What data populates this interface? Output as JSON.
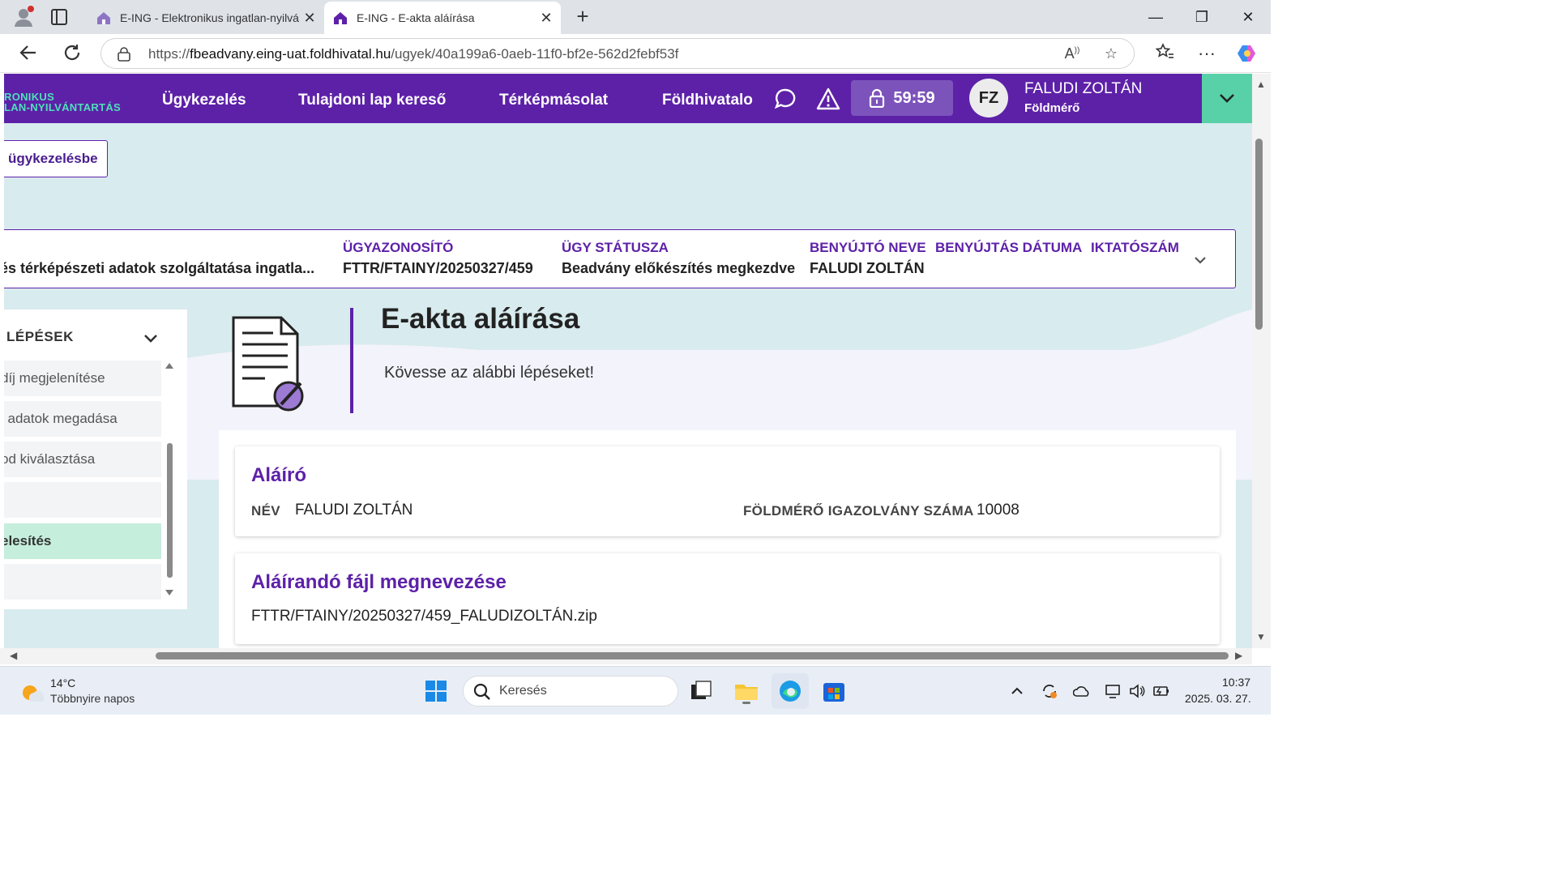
{
  "browser": {
    "tabs": [
      {
        "title": "E-ING - Elektronikus ingatlan-nyilvántartás",
        "active": false
      },
      {
        "title": "E-ING - E-akta aláírása",
        "active": true
      }
    ],
    "url_prefix": "https://",
    "url_host": "fbeadvany.eing-uat.foldhivatal.hu",
    "url_path": "/ugyek/40a199a6-0aeb-11f0-bf2e-562d2febf53f"
  },
  "header": {
    "logo_line1": "RONIKUS",
    "logo_line2": "LAN-NYILVÁNTARTÁS",
    "nav": [
      "Ügykezelés",
      "Tulajdoni lap kereső",
      "Térképmásolat",
      "Földhivatalo"
    ],
    "timer": "59:59",
    "avatar_initials": "FZ",
    "user_name": "FALUDI ZOLTÁN",
    "user_role": "Földmérő",
    "brand_color": "#5d21a8",
    "accent_color": "#58d1a8"
  },
  "back_button": "ügykezelésbe",
  "case_info": {
    "service_value": "és térképészeti adatok szolgáltatása ingatla...",
    "fields": [
      {
        "label": "ÜGYAZONOSÍTÓ",
        "value": "FTTR/FTAINY/20250327/459"
      },
      {
        "label": "ÜGY STÁTUSZA",
        "value": "Beadvány előkészítés megkezdve"
      },
      {
        "label": "BENYÚJTÓ NEVE",
        "value": "FALUDI ZOLTÁN"
      },
      {
        "label": "BENYÚJTÁS DÁTUMA",
        "value": ""
      },
      {
        "label": "IKTATÓSZÁM",
        "value": ""
      }
    ]
  },
  "steps": {
    "title": "LÉPÉSEK",
    "items": [
      {
        "label": "díj megjelenítése",
        "active": false
      },
      {
        "label": "i adatok megadása",
        "active": false
      },
      {
        "label": "od kiválasztása",
        "active": false
      },
      {
        "label": "",
        "active": false
      },
      {
        "label": "elesítés",
        "active": true
      },
      {
        "label": "",
        "active": false
      }
    ]
  },
  "hero": {
    "title": "E-akta aláírása",
    "subtitle": "Kövesse az alábbi lépéseket!"
  },
  "signer_card": {
    "title": "Aláíró",
    "name_label": "NÉV",
    "name_value": "FALUDI ZOLTÁN",
    "license_label": "FÖLDMÉRŐ IGAZOLVÁNY SZÁMA",
    "license_value": "10008"
  },
  "file_card": {
    "title": "Aláírandó fájl megnevezése",
    "file_name": "FTTR/FTAINY/20250327/459_FALUDIZOLTÁN.zip"
  },
  "taskbar": {
    "weather_temp": "14°C",
    "weather_desc": "Többnyire napos",
    "search_placeholder": "Keresés",
    "time": "10:37",
    "date": "2025. 03. 27."
  }
}
